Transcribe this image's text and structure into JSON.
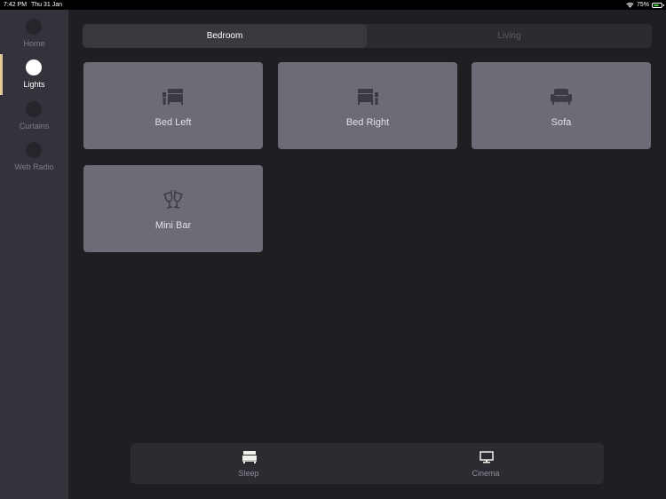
{
  "status_bar": {
    "time": "7:42 PM",
    "date": "Thu 31 Jan",
    "battery_percent_text": "75%",
    "battery_level": 0.75
  },
  "sidebar": {
    "items": [
      {
        "label": "Home",
        "active": false
      },
      {
        "label": "Lights",
        "active": true
      },
      {
        "label": "Curtains",
        "active": false
      },
      {
        "label": "Web Radio",
        "active": false
      }
    ],
    "accent_color": "#e6c99a"
  },
  "rooms": {
    "tabs": [
      {
        "label": "Bedroom",
        "selected": true
      },
      {
        "label": "Living",
        "selected": false
      }
    ]
  },
  "lights": [
    {
      "label": "Bed Left",
      "icon": "bed-left-icon"
    },
    {
      "label": "Bed Right",
      "icon": "bed-right-icon"
    },
    {
      "label": "Sofa",
      "icon": "sofa-icon"
    },
    {
      "label": "Mini Bar",
      "icon": "wine-glasses-icon"
    }
  ],
  "scenes": [
    {
      "label": "Sleep",
      "icon": "bed-icon"
    },
    {
      "label": "Cinema",
      "icon": "monitor-icon"
    }
  ],
  "colors": {
    "background": "#1f1e23",
    "sidebar": "#34333b",
    "tile": "#6c6b76"
  }
}
